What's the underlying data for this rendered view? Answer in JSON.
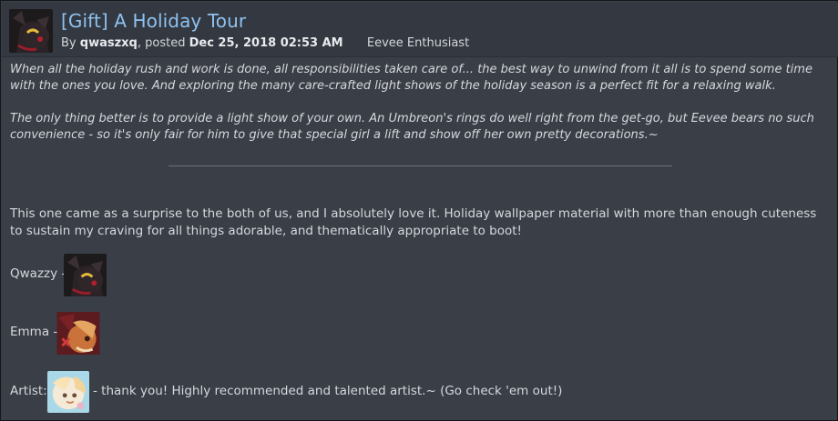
{
  "post": {
    "title": "[Gift] A Holiday Tour",
    "by_prefix": "By",
    "author": "qwaszxq",
    "posted_prefix": ", posted",
    "date": "Dec 25, 2018 02:53 AM",
    "user_title": "Eevee Enthusiast"
  },
  "body": {
    "intro_1": "When all the holiday rush and work is done, all responsibilities taken care of... the best way to unwind from it all is to spend some time with the ones you love. And exploring the many care-crafted light shows of the holiday season is a perfect fit for a relaxing walk.",
    "intro_2": "The only thing better is to provide a light show of your own. An Umbreon's rings do well right from the get-go, but Eevee bears no such convenience - so it's only fair for him to give that special girl a lift and show off her own pretty decorations.~",
    "description": "This one came as a surprise to the both of us, and I absolutely love it. Holiday wallpaper material with more than enough cuteness to sustain my craving for all things adorable, and thematically appropriate to boot!"
  },
  "characters": {
    "qwazzy_label": "Qwazzy -",
    "emma_label": "Emma -",
    "artist_label": "Artist:",
    "artist_note": "- thank you! Highly recommended and talented artist.~ (Go check 'em out!)"
  },
  "colors": {
    "title": "#8ec2f1",
    "background": "#3a3e46",
    "header": "#343840"
  }
}
